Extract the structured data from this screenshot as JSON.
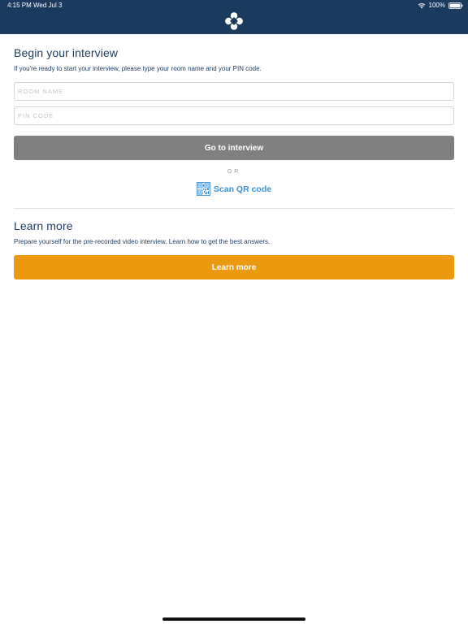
{
  "status_bar": {
    "time": "4:15 PM   Wed Jul 3",
    "battery": "100%"
  },
  "header": {
    "logo_icon": "clover-logo-icon",
    "color": "#1b3a5e"
  },
  "begin": {
    "title": "Begin your interview",
    "description": "If you're ready to start your interview, please type your room name and your PIN code.",
    "room_placeholder": "ROOM NAME",
    "room_value": "",
    "pin_placeholder": "PIN CODE",
    "pin_value": "",
    "go_label": "Go to interview",
    "go_color": "#808080"
  },
  "or_label": "OR",
  "qr": {
    "label": "Scan QR code",
    "icon": "qr-code-icon",
    "color": "#3d8fd1"
  },
  "learn": {
    "title": "Learn more",
    "description": "Prepare yourself for the pre-recorded video interview. Learn how to get the best answers.",
    "button_label": "Learn more",
    "button_color": "#eb990f"
  }
}
